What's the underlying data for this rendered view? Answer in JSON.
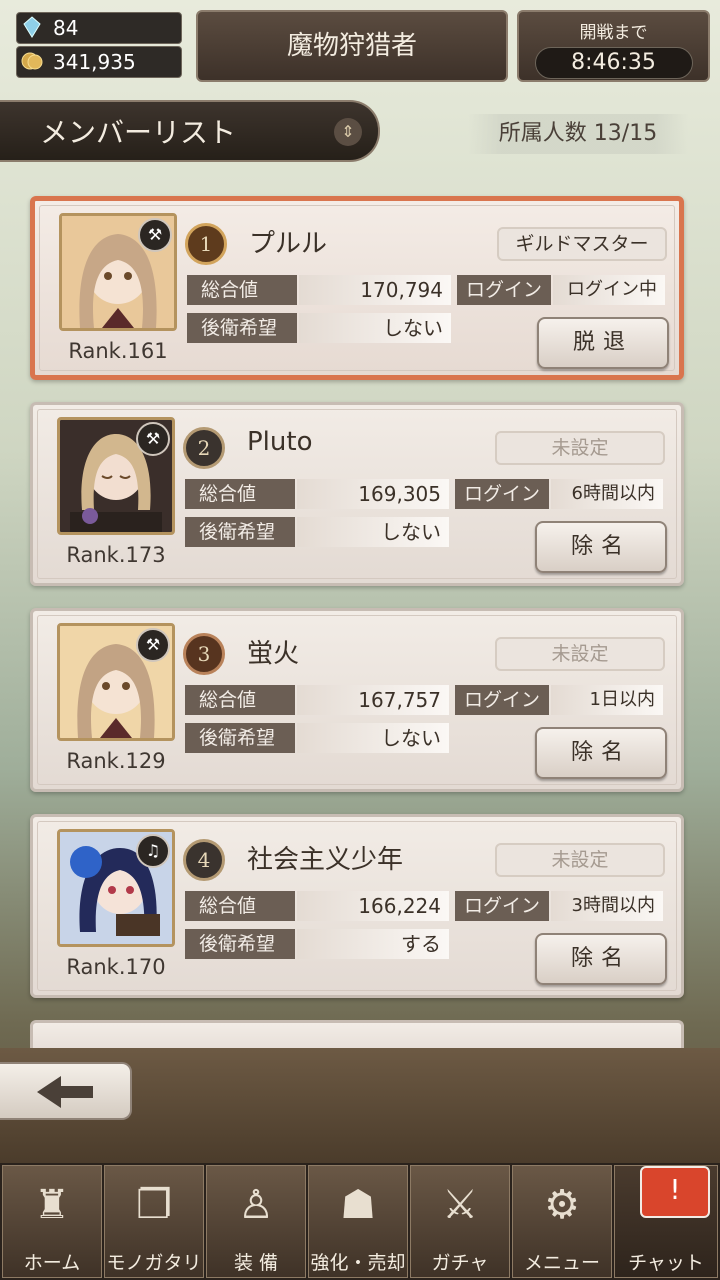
{
  "top": {
    "gems": "84",
    "gold": "341,935",
    "guild_name": "魔物狩猎者",
    "battle_label": "開戦まで",
    "battle_timer": "8:46:35"
  },
  "header": {
    "title": "メンバーリスト",
    "count": "所属人数 13/15"
  },
  "labels": {
    "total": "総合値",
    "login": "ログイン",
    "rear": "後衛希望"
  },
  "members": [
    {
      "num": "1",
      "name": "プルル",
      "role": "ギルドマスター",
      "total": "170,794",
      "login": "ログイン中",
      "rear": "しない",
      "rank": "Rank.161",
      "action": "脱退"
    },
    {
      "num": "2",
      "name": "Pluto",
      "role": "未設定",
      "total": "169,305",
      "login": "6時間以内",
      "rear": "しない",
      "rank": "Rank.173",
      "action": "除名"
    },
    {
      "num": "3",
      "name": "蛍火",
      "role": "未設定",
      "total": "167,757",
      "login": "1日以内",
      "rear": "しない",
      "rank": "Rank.129",
      "action": "除名"
    },
    {
      "num": "4",
      "name": "社会主义少年",
      "role": "未設定",
      "total": "166,224",
      "login": "3時間以内",
      "rear": "する",
      "rank": "Rank.170",
      "action": "除名"
    }
  ],
  "tabs": [
    {
      "label": "ホーム",
      "icon": "castle-icon"
    },
    {
      "label": "モノガタリ",
      "icon": "book-icon"
    },
    {
      "label": "装 備",
      "icon": "puppet-icon"
    },
    {
      "label": "強化・売却",
      "icon": "mask-icon"
    },
    {
      "label": "ガチャ",
      "icon": "swords-icon"
    },
    {
      "label": "メニュー",
      "icon": "gears-icon"
    },
    {
      "label": "チャット",
      "icon": "chat-icon"
    }
  ],
  "chat_badge": "!",
  "colors": {
    "accent": "#d9754e",
    "panel": "#6b5e54",
    "notify": "#d9452c"
  }
}
